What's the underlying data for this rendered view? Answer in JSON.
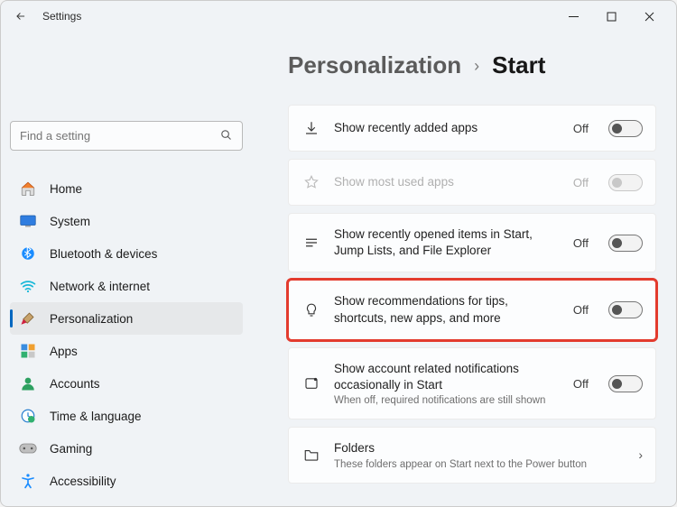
{
  "window": {
    "title": "Settings"
  },
  "search": {
    "placeholder": "Find a setting"
  },
  "sidebar": {
    "items": [
      {
        "label": "Home"
      },
      {
        "label": "System"
      },
      {
        "label": "Bluetooth & devices"
      },
      {
        "label": "Network & internet"
      },
      {
        "label": "Personalization"
      },
      {
        "label": "Apps"
      },
      {
        "label": "Accounts"
      },
      {
        "label": "Time & language"
      },
      {
        "label": "Gaming"
      },
      {
        "label": "Accessibility"
      }
    ]
  },
  "breadcrumb": {
    "parent": "Personalization",
    "current": "Start"
  },
  "cards": {
    "recently_added": {
      "title": "Show recently added apps",
      "state": "Off"
    },
    "most_used": {
      "title": "Show most used apps",
      "state": "Off"
    },
    "recent_items": {
      "title": "Show recently opened items in Start, Jump Lists, and File Explorer",
      "state": "Off"
    },
    "recommendations": {
      "title": "Show recommendations for tips, shortcuts, new apps, and more",
      "state": "Off"
    },
    "account_notifications": {
      "title": "Show account related notifications occasionally in Start",
      "sub": "When off, required notifications are still shown",
      "state": "Off"
    },
    "folders": {
      "title": "Folders",
      "sub": "These folders appear on Start next to the Power button"
    }
  }
}
